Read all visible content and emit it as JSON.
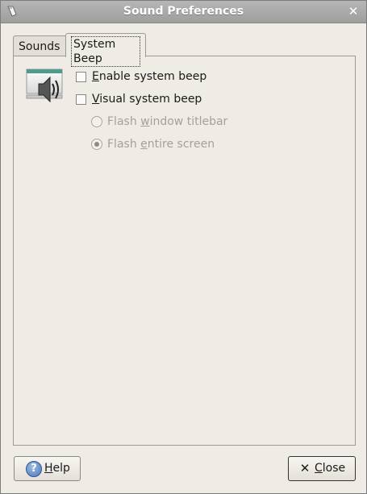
{
  "window": {
    "title": "Sound Preferences"
  },
  "tabs": [
    {
      "label": "Sounds",
      "active": false
    },
    {
      "label": "System Beep",
      "active": true
    }
  ],
  "options": {
    "enable_beep": {
      "mnemonic": "E",
      "rest": "nable system beep",
      "checked": false
    },
    "visual_beep": {
      "mnemonic": "V",
      "rest": "isual system beep",
      "checked": false
    },
    "flash_titlebar": {
      "pre": "Flash ",
      "mnemonic": "w",
      "rest": "indow titlebar",
      "selected": false,
      "enabled": false
    },
    "flash_screen": {
      "pre": "Flash ",
      "mnemonic": "e",
      "rest": "ntire screen",
      "selected": true,
      "enabled": false
    }
  },
  "buttons": {
    "help": {
      "mnemonic": "H",
      "rest": "elp",
      "icon": "help-icon"
    },
    "close": {
      "mnemonic": "C",
      "rest": "lose",
      "icon": "close-icon"
    }
  },
  "colors": {
    "titlebar": "#a8a8a8",
    "background": "#efebe5",
    "disabled_text": "#a4a19b"
  }
}
